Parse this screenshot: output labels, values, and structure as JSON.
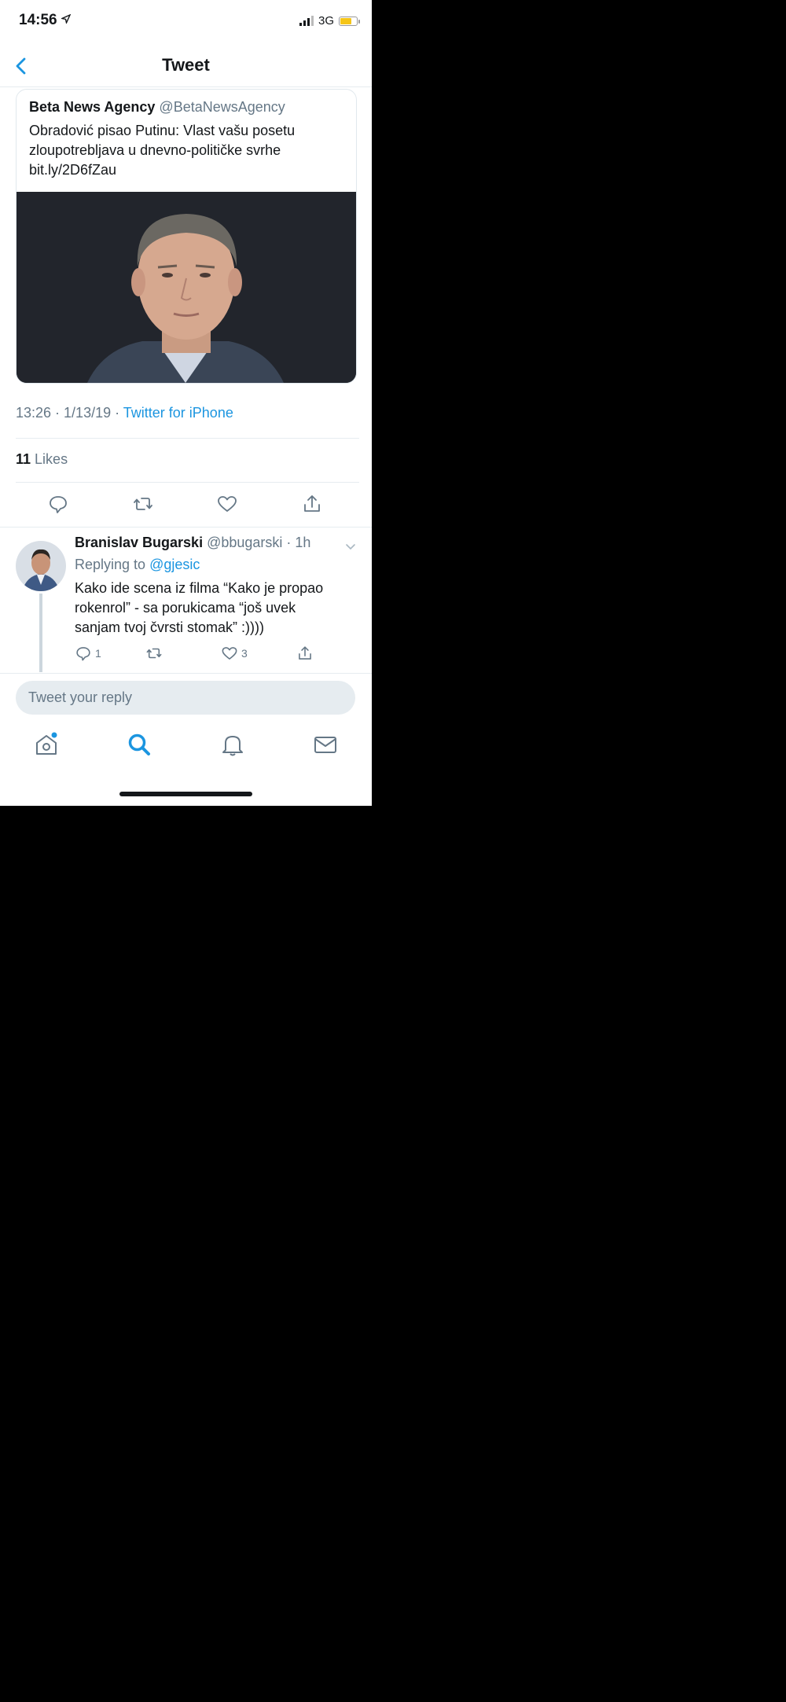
{
  "status_bar": {
    "time": "14:56",
    "network": "3G"
  },
  "nav": {
    "title": "Tweet"
  },
  "quoted_tweet": {
    "name": "Beta News Agency",
    "handle": "@BetaNewsAgency",
    "text_line1": "Obradović pisao Putinu: Vlast vašu posetu",
    "text_line2": "zloupotrebljava u dnevno-političke svrhe",
    "link": "bit.ly/2D6fZau"
  },
  "tweet_meta": {
    "time": "13:26",
    "date": "1/13/19",
    "source": "Twitter for iPhone"
  },
  "likes": {
    "count": "11",
    "label": "Likes"
  },
  "reply": {
    "name": "Branislav Bugarski",
    "handle": "@bbugarski",
    "age": "1h",
    "replying_label": "Replying to",
    "replying_to": "@gjesic",
    "text_line1": "Kako ide scena iz filma “Kako je propao",
    "text_line2": "rokenrol” - sa porukicama “još uvek",
    "text_line3": "sanjam tvoj čvrsti stomak” :))))",
    "reply_count": "1",
    "like_count": "3"
  },
  "compose": {
    "placeholder": "Tweet your reply"
  },
  "colors": {
    "accent": "#1b95e0",
    "battery": "#f5c518"
  },
  "icons": [
    "back-chevron-icon",
    "comment-icon",
    "retweet-icon",
    "heart-icon",
    "share-icon",
    "home-icon",
    "search-icon",
    "bell-icon",
    "mail-icon"
  ]
}
